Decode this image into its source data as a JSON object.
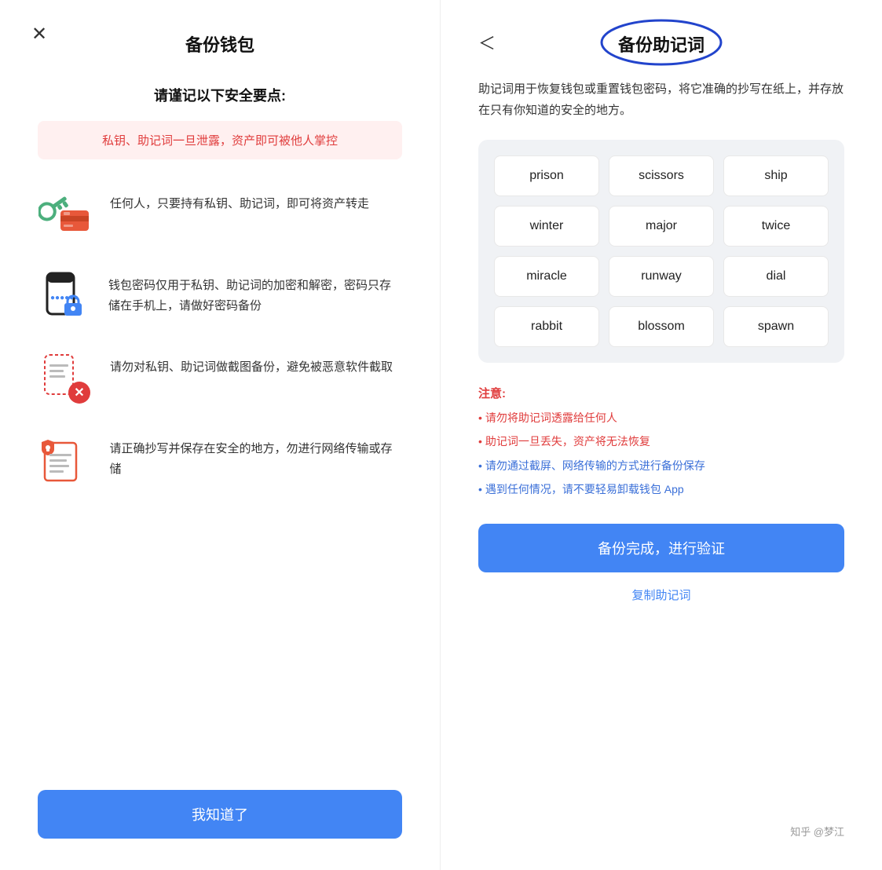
{
  "left": {
    "title": "备份钱包",
    "close_label": "✕",
    "subtitle": "请谨记以下安全要点:",
    "warning": "私钥、助记词一旦泄露，资产即可被他人掌控",
    "features": [
      {
        "id": "key-card",
        "text": "任何人，只要持有私钥、助记词，即可将资产转走"
      },
      {
        "id": "phone-lock",
        "text": "钱包密码仅用于私钥、助记词的加密和解密，密码只存储在手机上，请做好密码备份"
      },
      {
        "id": "screenshot",
        "text": "请勿对私钥、助记词做截图备份，避免被恶意软件截取"
      },
      {
        "id": "document",
        "text": "请正确抄写并保存在安全的地方，勿进行网络传输或存储"
      }
    ],
    "bottom_btn": "我知道了"
  },
  "right": {
    "back_label": "＜",
    "title": "备份助记词",
    "description": "助记词用于恢复钱包或重置钱包密码，将它准确的抄写在纸上，并存放在只有你知道的安全的地方。",
    "mnemonic_words": [
      "prison",
      "scissors",
      "ship",
      "winter",
      "major",
      "twice",
      "miracle",
      "runway",
      "dial",
      "rabbit",
      "blossom",
      "spawn"
    ],
    "notes_title": "注意:",
    "notes": [
      {
        "text": "请勿将助记词透露给任何人",
        "color": "red"
      },
      {
        "text": "助记词一旦丢失，资产将无法恢复",
        "color": "red"
      },
      {
        "text": "请勿通过截屏、网络传输的方式进行备份保存",
        "color": "blue"
      },
      {
        "text": "遇到任何情况，请不要轻易卸载钱包 App",
        "color": "blue"
      }
    ],
    "main_btn": "备份完成，进行验证",
    "copy_link": "复制助记词",
    "watermark": "知乎 @梦江"
  }
}
